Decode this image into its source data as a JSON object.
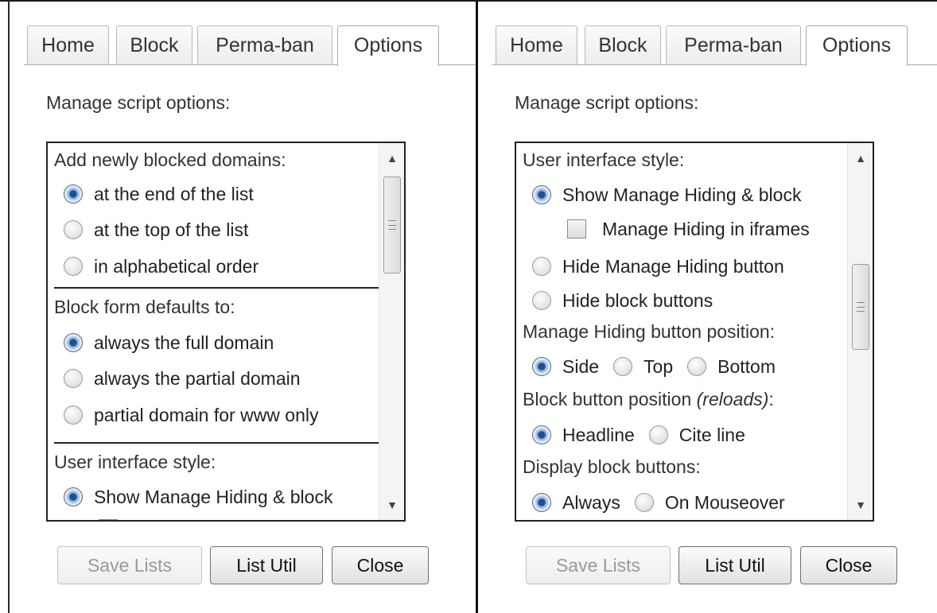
{
  "panels": [
    {
      "tabs": [
        {
          "label": "Home",
          "active": false
        },
        {
          "label": "Block",
          "active": false
        },
        {
          "label": "Perma-ban",
          "active": false
        },
        {
          "label": "Options",
          "active": true
        }
      ],
      "heading": "Manage script options:",
      "groups": [
        {
          "label": "Add newly blocked domains:",
          "options": [
            {
              "label": "at the end of the list",
              "selected": true
            },
            {
              "label": "at the top of the list",
              "selected": false
            },
            {
              "label": "in alphabetical order",
              "selected": false
            }
          ]
        },
        {
          "label": "Block form defaults to:",
          "options": [
            {
              "label": "always the full domain",
              "selected": true
            },
            {
              "label": "always the partial domain",
              "selected": false
            },
            {
              "label": "partial domain for www only",
              "selected": false
            }
          ]
        },
        {
          "label": "User interface style:",
          "options": [
            {
              "label": "Show Manage Hiding & block",
              "selected": true
            }
          ]
        }
      ],
      "scroll_fraction": 0.0,
      "buttons": {
        "save": "Save Lists",
        "list_util": "List Util",
        "close": "Close"
      }
    },
    {
      "tabs": [
        {
          "label": "Home",
          "active": false
        },
        {
          "label": "Block",
          "active": false
        },
        {
          "label": "Perma-ban",
          "active": false
        },
        {
          "label": "Options",
          "active": true
        }
      ],
      "heading": "Manage script options:",
      "ui_style": {
        "label": "User interface style:",
        "show_manage": {
          "label": "Show Manage Hiding & block",
          "selected": true
        },
        "iframes_checkbox": {
          "label": "Manage Hiding in iframes",
          "checked": false
        },
        "hide_manage": {
          "label": "Hide Manage Hiding button",
          "selected": false
        },
        "hide_block": {
          "label": "Hide block buttons",
          "selected": false
        }
      },
      "manage_position": {
        "label": "Manage Hiding button position:",
        "options": [
          {
            "label": "Side",
            "selected": true
          },
          {
            "label": "Top",
            "selected": false
          },
          {
            "label": "Bottom",
            "selected": false
          }
        ]
      },
      "block_position": {
        "label": "Block button position ",
        "note": "(reloads)",
        "suffix": ":",
        "options": [
          {
            "label": "Headline",
            "selected": true
          },
          {
            "label": "Cite line",
            "selected": false
          }
        ]
      },
      "display_block": {
        "label": "Display block buttons:",
        "options": [
          {
            "label": "Always",
            "selected": true
          },
          {
            "label": "On Mouseover",
            "selected": false
          }
        ]
      },
      "scroll_fraction": 0.5,
      "buttons": {
        "save": "Save Lists",
        "list_util": "List Util",
        "close": "Close"
      }
    }
  ]
}
